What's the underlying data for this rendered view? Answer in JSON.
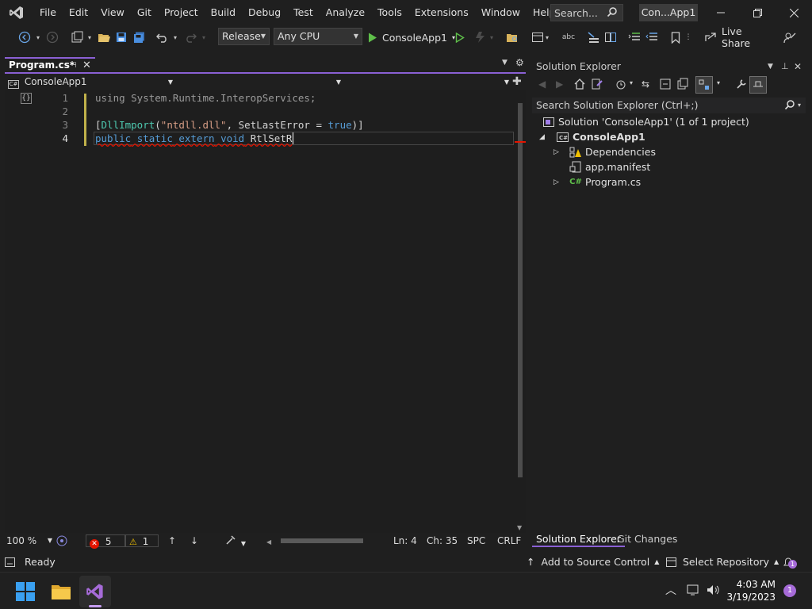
{
  "menu": [
    "File",
    "Edit",
    "View",
    "Git",
    "Project",
    "Build",
    "Debug",
    "Test",
    "Analyze",
    "Tools",
    "Extensions",
    "Window",
    "Help"
  ],
  "search_placeholder": "Search...",
  "solution_short_name": "Con...App1",
  "toolbar": {
    "config": "Release",
    "platform": "Any CPU",
    "start_target": "ConsoleApp1",
    "live_share": "Live Share"
  },
  "document_tab": {
    "label": "Program.cs*"
  },
  "navbar": {
    "project": "ConsoleApp1"
  },
  "code_lines": [
    {
      "num": "1",
      "code": "using System.Runtime.InteropServices;"
    },
    {
      "num": "2",
      "code": ""
    },
    {
      "num": "3",
      "code": "[DllImport(\"ntdll.dll\", SetLastError = true)]"
    },
    {
      "num": "4",
      "code": "public static extern void RtlSetR"
    }
  ],
  "editor_status": {
    "zoom": "100 %",
    "errors": "5",
    "warnings": "1",
    "line": "Ln: 4",
    "column": "Ch: 35",
    "whitespace": "SPC",
    "line_ending": "CRLF"
  },
  "solution_explorer": {
    "title": "Solution Explorer",
    "search_placeholder": "Search Solution Explorer (Ctrl+;)",
    "solution_label": "Solution 'ConsoleApp1' (1 of 1 project)",
    "project": "ConsoleApp1",
    "items": [
      "Dependencies",
      "app.manifest",
      "Program.cs"
    ],
    "tabs": [
      "Solution Explorer",
      "Git Changes"
    ]
  },
  "statusbar": {
    "state": "Ready",
    "source_control": "Add to Source Control",
    "repository": "Select Repository",
    "notifications": "1"
  },
  "clock": {
    "time": "4:03 AM",
    "date": "3/19/2023"
  },
  "colors": {
    "accent": "#8a60d4",
    "error": "#e51400",
    "warning": "#f0c000"
  }
}
